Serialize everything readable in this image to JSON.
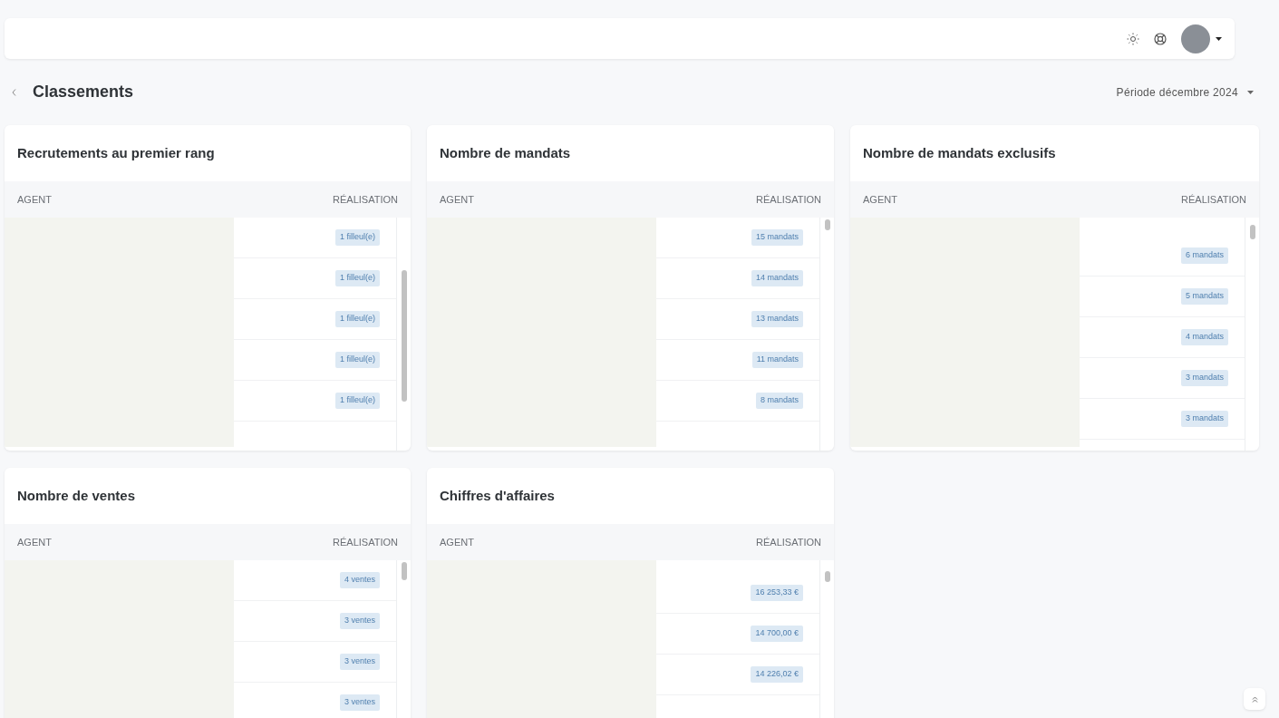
{
  "page": {
    "title": "Classements",
    "period": "Période décembre 2024"
  },
  "cards": [
    {
      "title": "Recrutements au premier rang",
      "columns": [
        "AGENT",
        "RÉALISATION"
      ],
      "rows": [
        "1 filleul(e)",
        "1 filleul(e)",
        "1 filleul(e)",
        "1 filleul(e)",
        "1 filleul(e)"
      ]
    },
    {
      "title": "Nombre de mandats",
      "columns": [
        "AGENT",
        "RÉALISATION"
      ],
      "rows": [
        "15 mandats",
        "14 mandats",
        "13 mandats",
        "11 mandats",
        "8 mandats"
      ]
    },
    {
      "title": "Nombre de mandats exclusifs",
      "columns": [
        "AGENT",
        "RÉALISATION"
      ],
      "rows": [
        "6 mandats",
        "5 mandats",
        "4 mandats",
        "3 mandats",
        "3 mandats"
      ]
    },
    {
      "title": "Nombre de ventes",
      "columns": [
        "AGENT",
        "RÉALISATION"
      ],
      "rows": [
        "4 ventes",
        "3 ventes",
        "3 ventes",
        "3 ventes"
      ]
    },
    {
      "title": "Chiffres d'affaires",
      "columns": [
        "AGENT",
        "RÉALISATION"
      ],
      "rows": [
        "16 253,33 €",
        "14 700,00 €",
        "14 226,02 €"
      ]
    }
  ]
}
